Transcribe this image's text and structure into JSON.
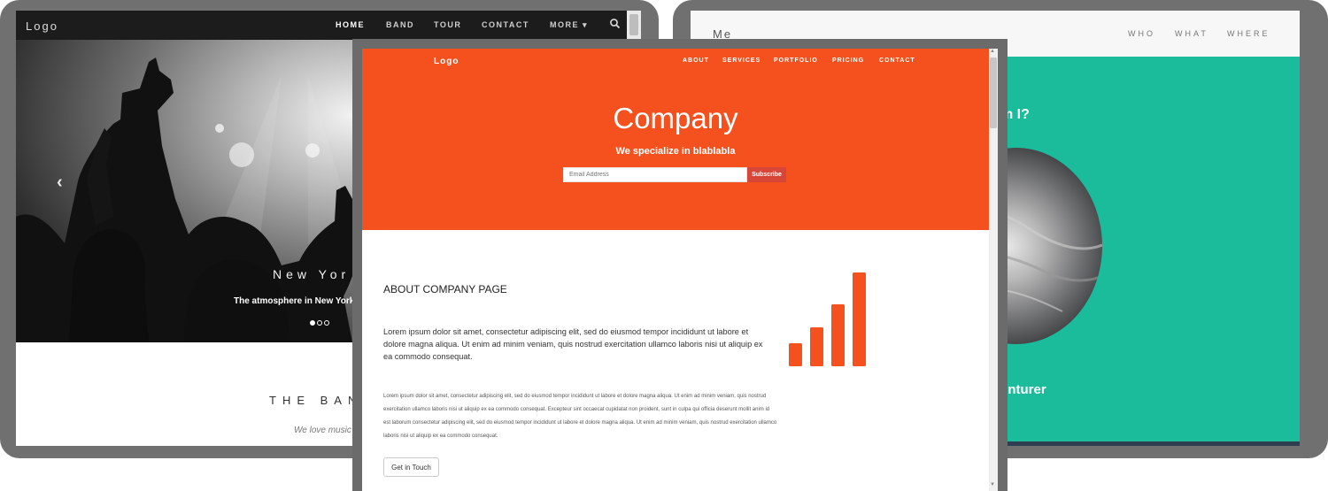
{
  "band_page": {
    "logo": "Logo",
    "nav": [
      "HOME",
      "BAND",
      "TOUR",
      "CONTACT",
      "MORE ▾"
    ],
    "active_nav": "HOME",
    "hero_city": "New Yor",
    "hero_caption": "The atmosphere in New York",
    "carousel_prev": "‹",
    "section_title": "THE BAN",
    "section_subtitle": "We love music"
  },
  "personal_page": {
    "logo": "Me",
    "nav": [
      "WHO",
      "WHAT",
      "WHERE"
    ],
    "hero_question": "m I?",
    "hero_role": "enturer",
    "accent_color": "#1abc9c"
  },
  "company_page": {
    "logo": "Logo",
    "nav": [
      "ABOUT",
      "SERVICES",
      "PORTFOLIO",
      "PRICING",
      "CONTACT"
    ],
    "title": "Company",
    "tagline": "We specialize in blablabla",
    "email_placeholder": "Email Address",
    "subscribe_label": "Subscribe",
    "about_heading": "ABOUT COMPANY PAGE",
    "about_lead": "Lorem ipsum dolor sit amet, consectetur adipiscing elit, sed do eiusmod tempor incididunt ut labore et dolore magna aliqua. Ut enim ad minim veniam, quis nostrud exercitation ullamco laboris nisi ut aliquip ex ea commodo consequat.",
    "about_body": "Lorem ipsum dolor sit amet, consectetur adipiscing elit, sed do eiusmod tempor incididunt ut labore et dolore magna aliqua. Ut enim ad minim veniam, quis nostrud exercitation ullamco laboris nisi ut aliquip ex ea commodo consequat. Excepteur sint occaecat cupidatat non proident, sunt in culpa qui officia deserunt mollit anim id est laborum consectetur adipiscing elit, sed do eiusmod tempor incididunt ut labore et dolore magna aliqua. Ut enim ad minim veniam, quis nostrud exercitation ullamco laboris nisi ut aliquip ex ea commodo consequat.",
    "cta_label": "Get in Touch",
    "accent_color": "#f4511e",
    "signal_icon_levels": [
      1,
      2,
      3,
      4
    ]
  }
}
